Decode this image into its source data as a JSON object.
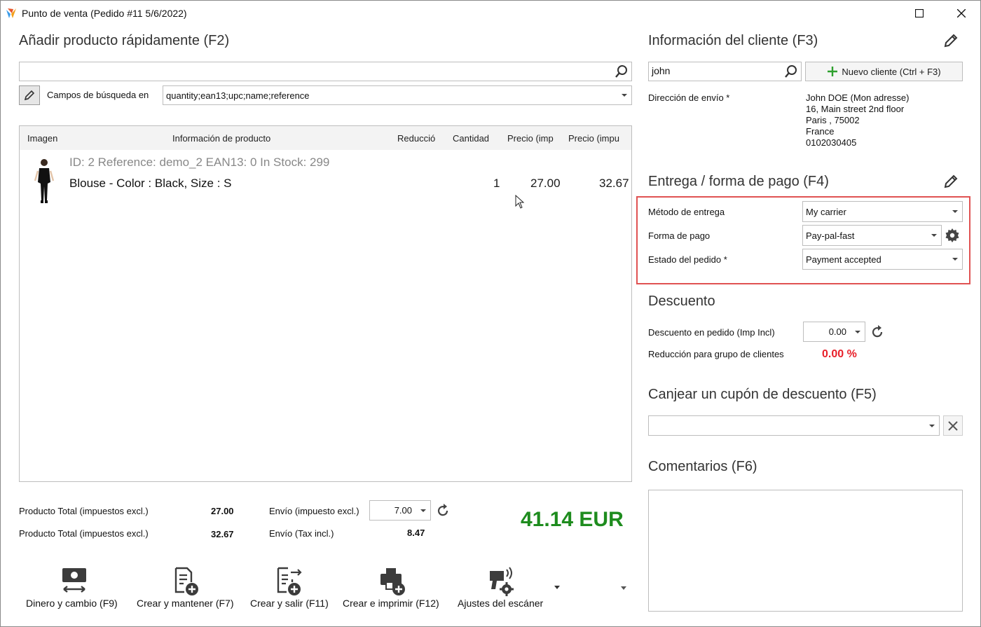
{
  "window": {
    "title": "Punto de venta (Pedido #11 5/6/2022)",
    "minimize_glyph": "☐",
    "close_glyph": "✕"
  },
  "add_product": {
    "title": "Añadir producto rápidamente (F2)",
    "search_value": "",
    "fields_label": "Campos de búsqueda en",
    "fields_value": "quantity;ean13;upc;name;reference"
  },
  "grid": {
    "columns": [
      "Imagen",
      "Información de producto",
      "Reducció",
      "Cantidad",
      "Precio (imp",
      "Precio (impu"
    ],
    "rows": [
      {
        "info_line": "ID: 2 Reference: demo_2 EAN13: 0 In Stock: 299",
        "name": "Blouse - Color : Black, Size : S",
        "quantity": "1",
        "price_excl": "27.00",
        "price_incl": "32.67"
      }
    ]
  },
  "totals": {
    "product_total_excl_label": "Producto Total (impuestos excl.)",
    "product_total_excl_value": "27.00",
    "product_total_incl_label": "Producto Total (impuestos excl.)",
    "product_total_incl_value": "32.67",
    "shipping_excl_label": "Envío (impuesto excl.)",
    "shipping_excl_value": "7.00",
    "shipping_incl_label": "Envío (Tax incl.)",
    "shipping_incl_value": "8.47",
    "grand_total": "41.14 EUR"
  },
  "actions": [
    {
      "label": "Dinero y cambio (F9)"
    },
    {
      "label": "Crear y mantener (F7)"
    },
    {
      "label": "Crear y salir (F11)"
    },
    {
      "label": "Crear e imprimir (F12)"
    },
    {
      "label": "Ajustes del escáner"
    }
  ],
  "customer": {
    "title": "Información del cliente (F3)",
    "search_value": "john",
    "new_button": "Nuevo cliente (Ctrl + F3)",
    "address_label": "Dirección de envío *",
    "address_lines": [
      "John DOE (Mon adresse)",
      "16, Main street 2nd floor",
      "Paris ,  75002",
      "France",
      "0102030405"
    ]
  },
  "delivery": {
    "title": "Entrega / forma de pago (F4)",
    "carrier_label": "Método de entrega",
    "carrier_value": "My carrier",
    "payment_label": "Forma de pago",
    "payment_value": "Pay-pal-fast",
    "status_label": "Estado del pedido *",
    "status_value": "Payment accepted"
  },
  "discount": {
    "title": "Descuento",
    "order_discount_label": "Descuento en pedido (Imp Incl)",
    "order_discount_value": "0.00",
    "group_label": "Reducción para grupo de clientes",
    "group_value": "0.00 %"
  },
  "coupon": {
    "title": "Canjear un cupón de descuento (F5)",
    "value": ""
  },
  "comments": {
    "title": "Comentarios (F6)",
    "value": ""
  },
  "colors": {
    "accent_green": "#1e8c1e",
    "discount_red": "#e8202a",
    "highlight_red": "#e05252"
  }
}
